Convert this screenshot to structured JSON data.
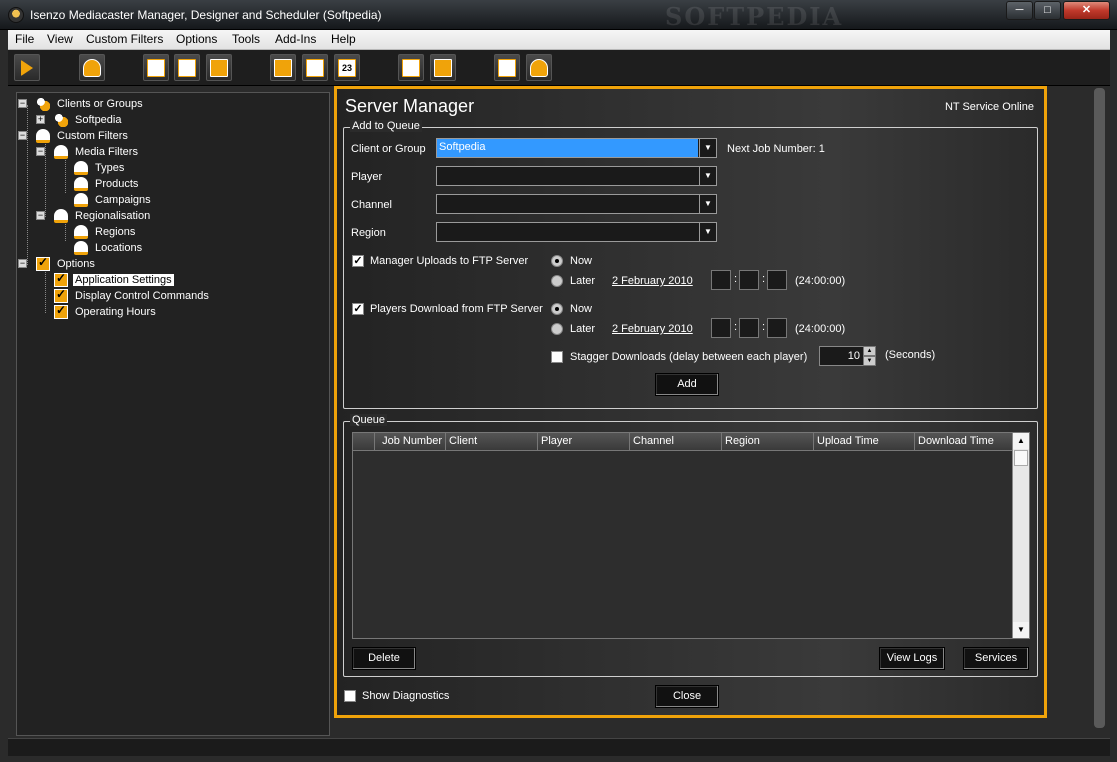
{
  "window": {
    "title": "Isenzo Mediacaster Manager, Designer and Scheduler (Softpedia)",
    "watermark": "SOFTPEDIA",
    "min_glyph": "─",
    "max_glyph": "□",
    "close_glyph": "✕"
  },
  "menu": {
    "items": [
      "File",
      "View",
      "Custom Filters",
      "Options",
      "Tools",
      "Add-Ins",
      "Help"
    ]
  },
  "toolbar": {
    "icons": [
      "play-icon",
      "users-icon",
      "clapperboard-icon",
      "document-icon",
      "layout-icon",
      "monitor-icon",
      "link-icon",
      "calendar-icon",
      "hierarchy-icon",
      "film-icon",
      "report-icon",
      "user-lock-icon"
    ],
    "calendar_label": "23"
  },
  "tree": {
    "nodes": [
      {
        "label": "Clients or Groups",
        "expander": "−",
        "icon": "group"
      },
      {
        "label": "Softpedia",
        "expander": "+",
        "icon": "group"
      },
      {
        "label": "Custom Filters",
        "expander": "−",
        "icon": "person"
      },
      {
        "label": "Media Filters",
        "expander": "−",
        "icon": "person"
      },
      {
        "label": "Types",
        "expander": "",
        "icon": "person"
      },
      {
        "label": "Products",
        "expander": "",
        "icon": "person"
      },
      {
        "label": "Campaigns",
        "expander": "",
        "icon": "person"
      },
      {
        "label": "Regionalisation",
        "expander": "−",
        "icon": "person"
      },
      {
        "label": "Regions",
        "expander": "",
        "icon": "person"
      },
      {
        "label": "Locations",
        "expander": "",
        "icon": "person"
      },
      {
        "label": "Options",
        "expander": "−",
        "icon": "check"
      },
      {
        "label": "Application Settings",
        "expander": "",
        "icon": "check",
        "selected": true
      },
      {
        "label": "Display Control Commands",
        "expander": "",
        "icon": "check"
      },
      {
        "label": "Operating Hours",
        "expander": "",
        "icon": "check"
      }
    ]
  },
  "server_manager": {
    "title": "Server Manager",
    "status": "NT Service Online",
    "add_to_queue": {
      "legend": "Add to Queue",
      "client_label": "Client or Group",
      "client_value": "Softpedia",
      "next_job": "Next Job Number: 1",
      "player_label": "Player",
      "player_value": "",
      "channel_label": "Channel",
      "channel_value": "",
      "region_label": "Region",
      "region_value": "",
      "upload_label": "Manager Uploads to FTP Server",
      "upload_checked": "✓",
      "download_label": "Players Download from FTP Server",
      "download_checked": "✓",
      "now_label": "Now",
      "later_label": "Later",
      "upload_date": "2 February 2010",
      "download_date": "2 February 2010",
      "time_sep": ":",
      "time_hint": "(24:00:00)",
      "stagger_label": "Stagger Downloads (delay between each player)",
      "stagger_value": "10",
      "seconds_label": "(Seconds)",
      "add_button": "Add"
    },
    "queue": {
      "legend": "Queue",
      "columns": [
        "",
        "Job Number",
        "Client",
        "Player",
        "Channel",
        "Region",
        "Upload Time",
        "Download Time"
      ],
      "delete_button": "Delete",
      "view_logs_button": "View Logs",
      "services_button": "Services"
    },
    "show_diagnostics": "Show Diagnostics",
    "close_button": "Close"
  },
  "colors": {
    "accent": "#f0a30a",
    "selection": "#3399ff"
  }
}
